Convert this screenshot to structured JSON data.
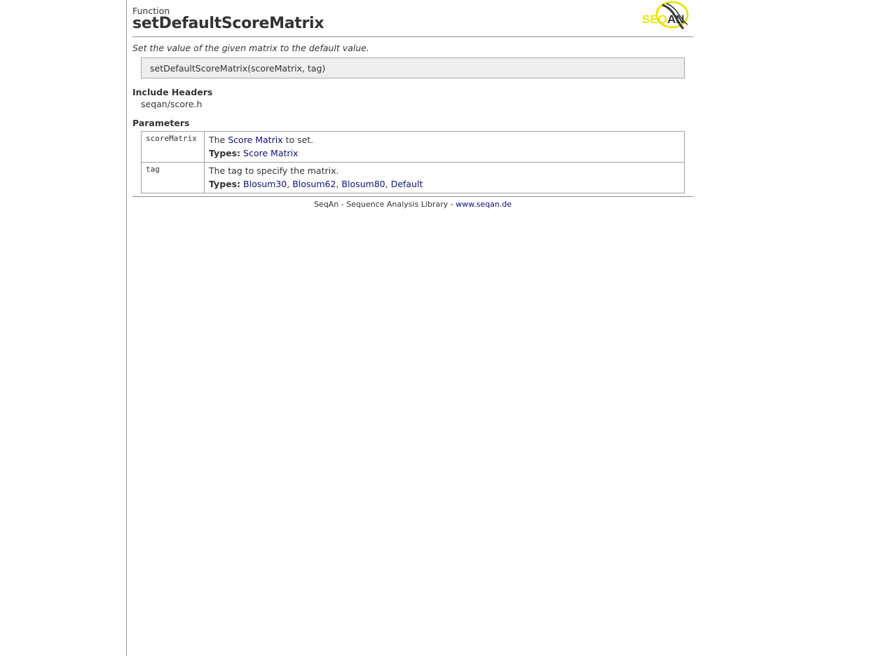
{
  "header": {
    "kind": "Function",
    "title": "setDefaultScoreMatrix",
    "logo_text": "SEQAN"
  },
  "summary": "Set the value of the given matrix to the default value.",
  "signature": "setDefaultScoreMatrix(scoreMatrix, tag)",
  "include": {
    "heading": "Include Headers",
    "items": [
      "seqan/score.h"
    ]
  },
  "parameters": {
    "heading": "Parameters",
    "types_label": "Types:",
    "rows": [
      {
        "name": "scoreMatrix",
        "desc_before": "The ",
        "desc_link": "Score Matrix",
        "desc_after": " to set.",
        "types": [
          "Score Matrix"
        ]
      },
      {
        "name": "tag",
        "desc_before": "The tag to specify the matrix.",
        "types": [
          "Blosum30",
          "Blosum62",
          "Blosum80",
          "Default"
        ]
      }
    ]
  },
  "footer": {
    "text": "SeqAn - Sequence Analysis Library - ",
    "link": "www.seqan.de"
  },
  "colors": {
    "link": "#10107a",
    "logo_yellow": "#e8e51a",
    "logo_dark": "#3a3a3a"
  }
}
